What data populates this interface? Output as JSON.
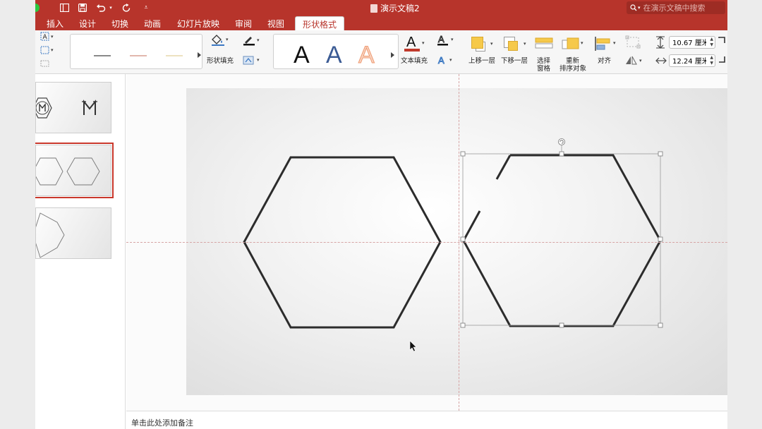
{
  "window": {
    "title": "演示文稿2",
    "search_placeholder": "在演示文稿中搜索"
  },
  "tabs": [
    {
      "label": "插入"
    },
    {
      "label": "设计"
    },
    {
      "label": "切换"
    },
    {
      "label": "动画"
    },
    {
      "label": "幻灯片放映"
    },
    {
      "label": "审阅"
    },
    {
      "label": "视图"
    },
    {
      "label": "形状格式",
      "active": true
    }
  ],
  "ribbon": {
    "shape_fill_label": "形状填充",
    "text_fill_label": "文本填充",
    "bring_forward_label": "上移一层",
    "send_backward_label": "下移一层",
    "selection_pane_label": [
      "选择",
      "窗格"
    ],
    "reorder_label": [
      "重新",
      "排序对象"
    ],
    "align_label": "对齐",
    "height_value": "10.67 厘米",
    "width_value": "12.24 厘米",
    "wordart_letters": [
      "A",
      "A",
      "A"
    ],
    "colors": {
      "accent": "#b7342b",
      "text_fill": "#c0392b",
      "wordart_blue": "#3b5b94",
      "wordart_orange": "#f2a07a"
    }
  },
  "notes_placeholder": "单击此处添加备注",
  "icons": [
    "save-icon",
    "undo-icon",
    "redo-icon",
    "search-icon",
    "shape-fill-icon",
    "pen-icon",
    "text-fill-icon",
    "align-icon",
    "rotate-icon",
    "height-icon",
    "width-icon"
  ]
}
